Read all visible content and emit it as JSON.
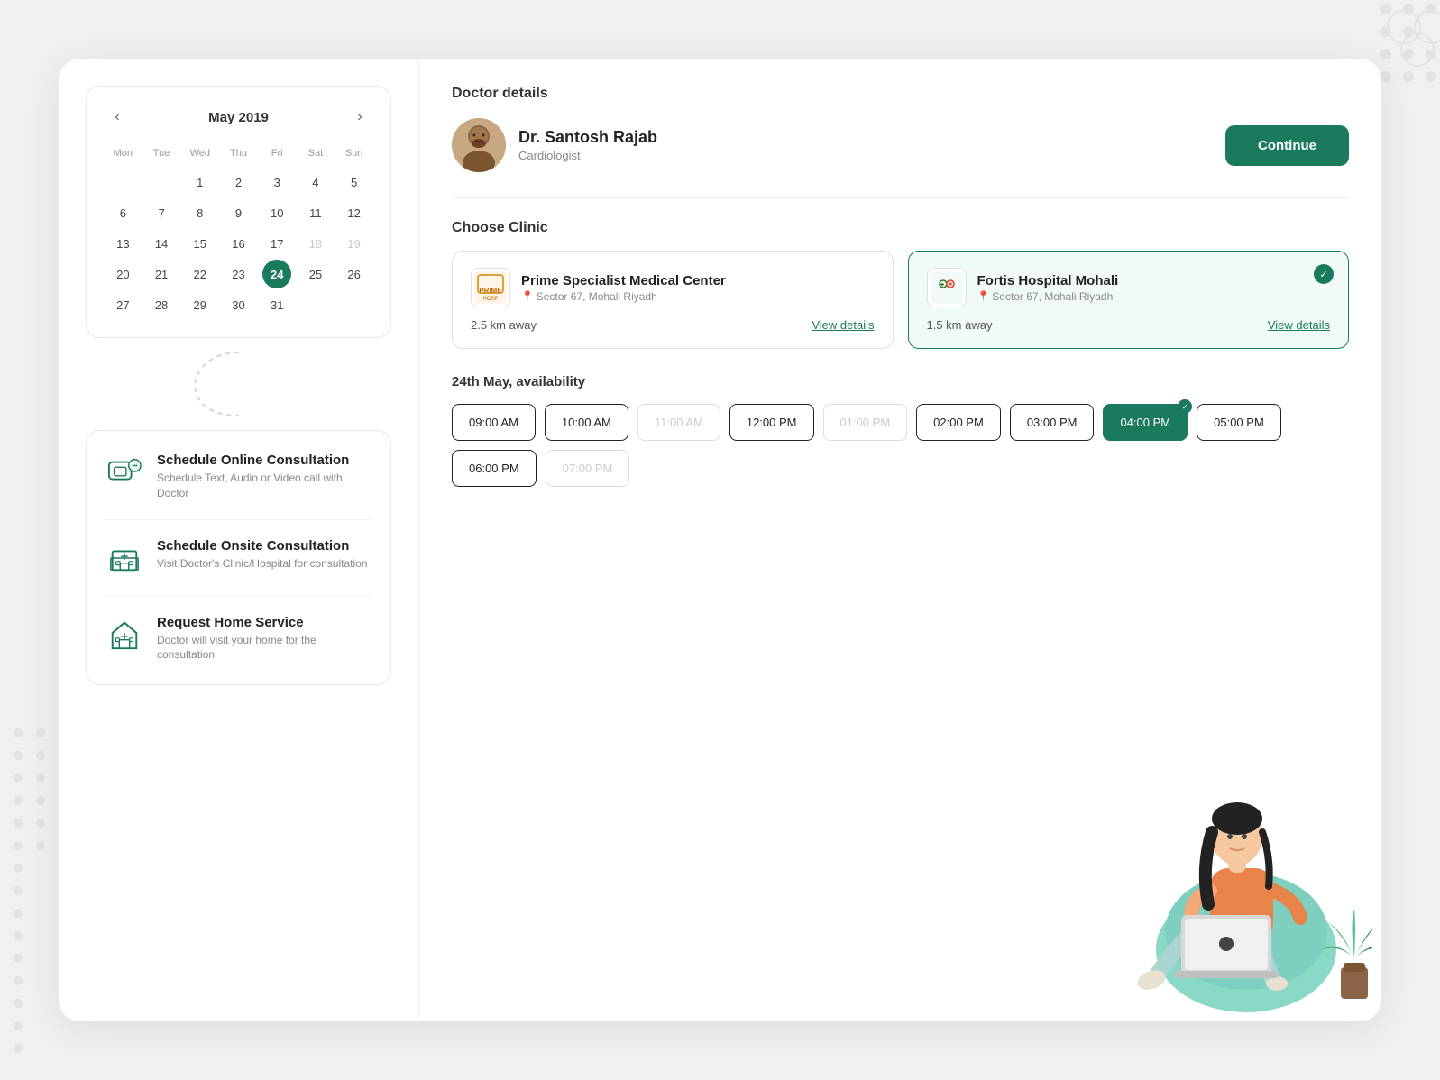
{
  "background_color": "#f0f0f0",
  "calendar": {
    "month_year": "May 2019",
    "day_headers": [
      "Mon",
      "Tue",
      "Wed",
      "Thu",
      "Fri",
      "Sat",
      "Sun"
    ],
    "weeks": [
      [
        null,
        null,
        1,
        2,
        3,
        4,
        5
      ],
      [
        null,
        null,
        null,
        null,
        null,
        null,
        null
      ],
      [
        6,
        7,
        8,
        9,
        10,
        11,
        12
      ],
      [
        13,
        14,
        15,
        16,
        17,
        18,
        19
      ],
      [
        20,
        21,
        22,
        23,
        24,
        25,
        26
      ],
      [
        27,
        28,
        29,
        30,
        31,
        null,
        null
      ]
    ],
    "selected_day": 24,
    "prev_icon": "‹",
    "next_icon": "›"
  },
  "doctor": {
    "section_title": "Doctor details",
    "name": "Dr. Santosh Rajab",
    "specialty": "Cardiologist",
    "continue_label": "Continue"
  },
  "clinics": {
    "section_title": "Choose Clinic",
    "items": [
      {
        "name": "Prime Specialist Medical Center",
        "location": "Sector 67, Mohali Riyadh",
        "distance": "2.5 km away",
        "view_details": "View details",
        "selected": false
      },
      {
        "name": "Fortis Hospital Mohali",
        "location": "Sector 67, Mohali Riyadh",
        "distance": "1.5 km away",
        "view_details": "View details",
        "selected": true
      }
    ]
  },
  "availability": {
    "title": "24th May, availability",
    "slots": [
      {
        "time": "09:00 AM",
        "state": "normal"
      },
      {
        "time": "10:00 AM",
        "state": "normal"
      },
      {
        "time": "11:00 AM",
        "state": "muted"
      },
      {
        "time": "12:00 PM",
        "state": "normal"
      },
      {
        "time": "01:00 PM",
        "state": "muted"
      },
      {
        "time": "02:00 PM",
        "state": "normal"
      },
      {
        "time": "03:00 PM",
        "state": "normal"
      },
      {
        "time": "04:00 PM",
        "state": "selected"
      },
      {
        "time": "05:00 PM",
        "state": "normal"
      },
      {
        "time": "06:00 PM",
        "state": "normal"
      },
      {
        "time": "07:00 PM",
        "state": "muted"
      }
    ]
  },
  "services": [
    {
      "title": "Schedule Online Consultation",
      "desc": "Schedule Text, Audio or Video call with Doctor",
      "icon": "phone-chat"
    },
    {
      "title": "Schedule Onsite Consultation",
      "desc": "Visit Doctor's Clinic/Hospital for consultation",
      "icon": "hospital"
    },
    {
      "title": "Request Home Service",
      "desc": "Doctor will visit your home for the consultation",
      "icon": "home-medical"
    }
  ]
}
